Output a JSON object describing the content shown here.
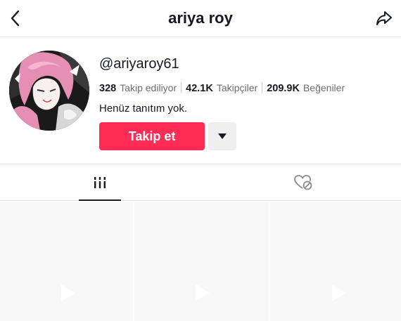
{
  "header": {
    "title": "ariya roy",
    "back_icon": "chevron-left-icon",
    "share_icon": "share-arrow-icon"
  },
  "profile": {
    "username": "@ariyaroy61",
    "bio": "Henüz tanıtım yok.",
    "avatar_icon": "anime-avatar-image",
    "stats": [
      {
        "value": "328",
        "label": "Takip ediliyor"
      },
      {
        "value": "42.1K",
        "label": "Takipçiler"
      },
      {
        "value": "209.9K",
        "label": "Beğeniler"
      }
    ]
  },
  "actions": {
    "follow_label": "Takip et",
    "more_icon": "triangle-down-icon"
  },
  "tabs": {
    "videos_icon": "grid-bars-icon",
    "liked_icon": "heart-hidden-icon",
    "active": "videos"
  },
  "grid": {
    "tiles": [
      {
        "icon": "play-icon"
      },
      {
        "icon": "play-icon"
      },
      {
        "icon": "play-icon"
      }
    ]
  },
  "colors": {
    "accent": "#fe2c55",
    "text": "#161823",
    "muted": "#6b6c73",
    "tile_bg": "#f8f8f8"
  }
}
